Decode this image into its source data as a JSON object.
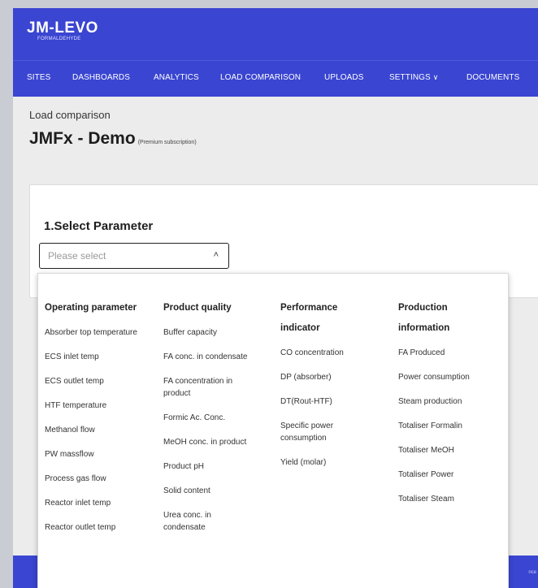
{
  "brand": {
    "name": "JM-LEVO",
    "sub": "FORMALDEHYDE"
  },
  "nav": [
    {
      "label": "SITES"
    },
    {
      "label": "DASHBOARDS"
    },
    {
      "label": "ANALYTICS"
    },
    {
      "label": "LOAD COMPARISON"
    },
    {
      "label": "UPLOADS"
    },
    {
      "label": "SETTINGS",
      "caret": "∨"
    },
    {
      "label": "DOCUMENTS"
    }
  ],
  "breadcrumb": "Load comparison",
  "page_title": "JMFx - Demo",
  "subscription": "(Premium subscription)",
  "card_title": "1.Select Parameter",
  "select": {
    "placeholder": "Please select",
    "arrow": "˄"
  },
  "columns": [
    {
      "heading": "Operating parameter",
      "items": [
        "Absorber top temperature",
        "ECS inlet temp",
        "ECS outlet temp",
        "HTF temperature",
        "Methanol flow",
        "PW massflow",
        "Process gas flow",
        "Reactor inlet temp",
        "Reactor outlet temp"
      ]
    },
    {
      "heading": "Product quality",
      "items": [
        "Buffer capacity",
        "FA conc. in condensate",
        "FA concentration in product",
        "Formic Ac. Conc.",
        "MeOH conc. in product",
        "Product pH",
        "Solid content",
        "Urea conc. in condensate"
      ]
    },
    {
      "heading": "Performance indicator",
      "items": [
        "CO concentration",
        "DP (absorber)",
        "DT(Rout-HTF)",
        "Specific power consumption",
        "Yield (molar)"
      ]
    },
    {
      "heading": "Production information",
      "items": [
        "FA Produced",
        "Power consumption",
        "Steam production",
        "Totaliser Formalin",
        "Totaliser MeOH",
        "Totaliser Power",
        "Totaliser Steam"
      ]
    }
  ],
  "footer_text": "nce",
  "colors": {
    "brand": "#3a45d1",
    "page_bg": "#ececec"
  }
}
